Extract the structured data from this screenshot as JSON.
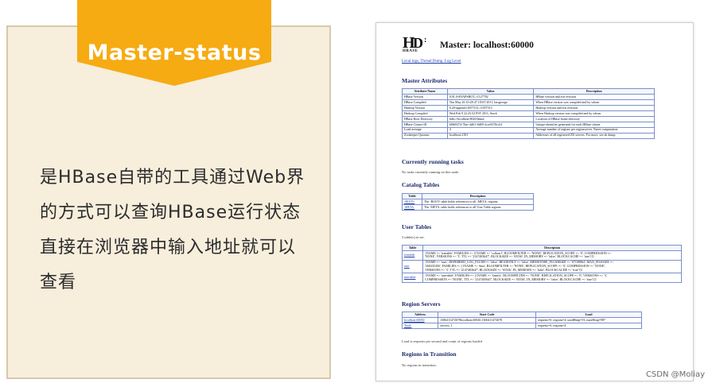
{
  "card": {
    "badge": "Master-status",
    "description": "是HBase自带的工具通过Web界的方式可以查询HBase运行状态直接在浏览器中输入地址就可以查看"
  },
  "screenshot": {
    "logo_text": "HBASE",
    "title": "Master: localhost:60000",
    "links": "Local logs, Thread Dump, Log Level",
    "sections": {
      "master_attributes": "Master Attributes",
      "running_tasks": "Currently running tasks",
      "catalog_tables": "Catalog Tables",
      "user_tables": "User Tables",
      "region_servers": "Region Servers",
      "regions_in_transition": "Regions in Transition"
    },
    "attributes_table": {
      "headers": [
        "Attribute Name",
        "Value",
        "Description"
      ],
      "rows": [
        [
          "HBase Version",
          "0.91.0-SNAPSHOT, r1127782",
          "HBase version and svn revision"
        ],
        [
          "HBase Compiled",
          "Thu May 26 10:28:47 CEST 2011, larsgeorge",
          "When HBase version was compiled and by whom"
        ],
        [
          "Hadoop Version",
          "0.20-append-r1057313, r1057313",
          "Hadoop version and svn revision"
        ],
        [
          "Hadoop Compiled",
          "Wed Feb 9 22:25:52 PST 2011, Stack",
          "When Hadoop version was compiled and by whom"
        ],
        [
          "HBase Root Directory",
          "hdfs://localhost:8020/hbase",
          "Location of HBase home directory"
        ],
        [
          "HBase Cluster ID",
          "6f9b9374-78ac-4d01-8d09-3cce9378c41f",
          "Unique identifier generated for each HBase cluster"
        ],
        [
          "Load average",
          "4",
          "Average number of regions per regionserver. Naive computation."
        ],
        [
          "Zookeeper Quorum",
          "localhost:2181",
          "Addresses of all registered ZK servers. For more, see zk dump."
        ]
      ]
    },
    "running_tasks_note": "No tasks currently running on this node.",
    "catalog_table": {
      "headers": [
        "Table",
        "Description"
      ],
      "rows": [
        [
          "-ROOT-",
          "The -ROOT- table holds references to all .META. regions."
        ],
        [
          ".META.",
          "The .META. table holds references to all User Table regions"
        ]
      ]
    },
    "user_tables_note": "3 table(s) in set.",
    "user_table": {
      "headers": [
        "Table",
        "Description"
      ],
      "rows": [
        [
          "testtable",
          "{NAME => 'testtable', FAMILIES => [{NAME => 'colfam1', BLOOMFILTER => 'NONE', REPLICATION_SCOPE => '0', COMPRESSION =>",
          "'NONE', VERSIONS => '3', TTL => '2147483647', BLOCKSIZE => '65536', IN_MEMORY => 'false', BLOCKCACHE => 'true'}]}"
        ],
        [
          "user",
          "{NAME => 'user', DEFERRED_LOG_FLUSH => 'false', READONLY => 'false', MEMSTORE_FLUSHSIZE => '67108864', MAX_FILESIZE =>",
          "'268435456', FAMILIES => [{NAME => 'data', BLOOMFILTER => 'NONE', REPLICATION_SCOPE => '0', COMPRESSION => 'NONE',",
          "VERSIONS => '3', TTL => '2147483647', BLOCKSIZE => '65536', IN_MEMORY => 'false', BLOCKCACHE => 'true'}]}"
        ],
        [
          "usertable",
          "{NAME => 'usertable', FAMILIES => [{NAME => 'family', BLOOMFILTER => 'NONE', REPLICATION_SCOPE => '0', VERSIONS => '3',",
          "COMPRESSION => 'NONE', TTL => '2147483647', BLOCKSIZE => '65536', IN_MEMORY => 'false', BLOCKCACHE => 'true'}]}"
        ]
      ]
    },
    "region_table": {
      "headers": [
        "Address",
        "Start Code",
        "Load"
      ],
      "rows": [
        [
          "localhost:60030",
          "1306411472678localhost,60020,1306411472678",
          "requests=0, regions=4, usedHeap=53, maxHeap=987"
        ],
        [
          "Total:",
          "servers: 1",
          "requests=0, regions=4"
        ]
      ]
    },
    "region_note": "Load is requests per second and count of regions loaded",
    "transition_note": "No regions in transition."
  },
  "watermark": "CSDN @Moliay",
  "colors": {
    "badge": "#f6ab12",
    "card_bg": "#f7eedc",
    "link": "#1a3da8",
    "section": "#1b2a6b"
  }
}
